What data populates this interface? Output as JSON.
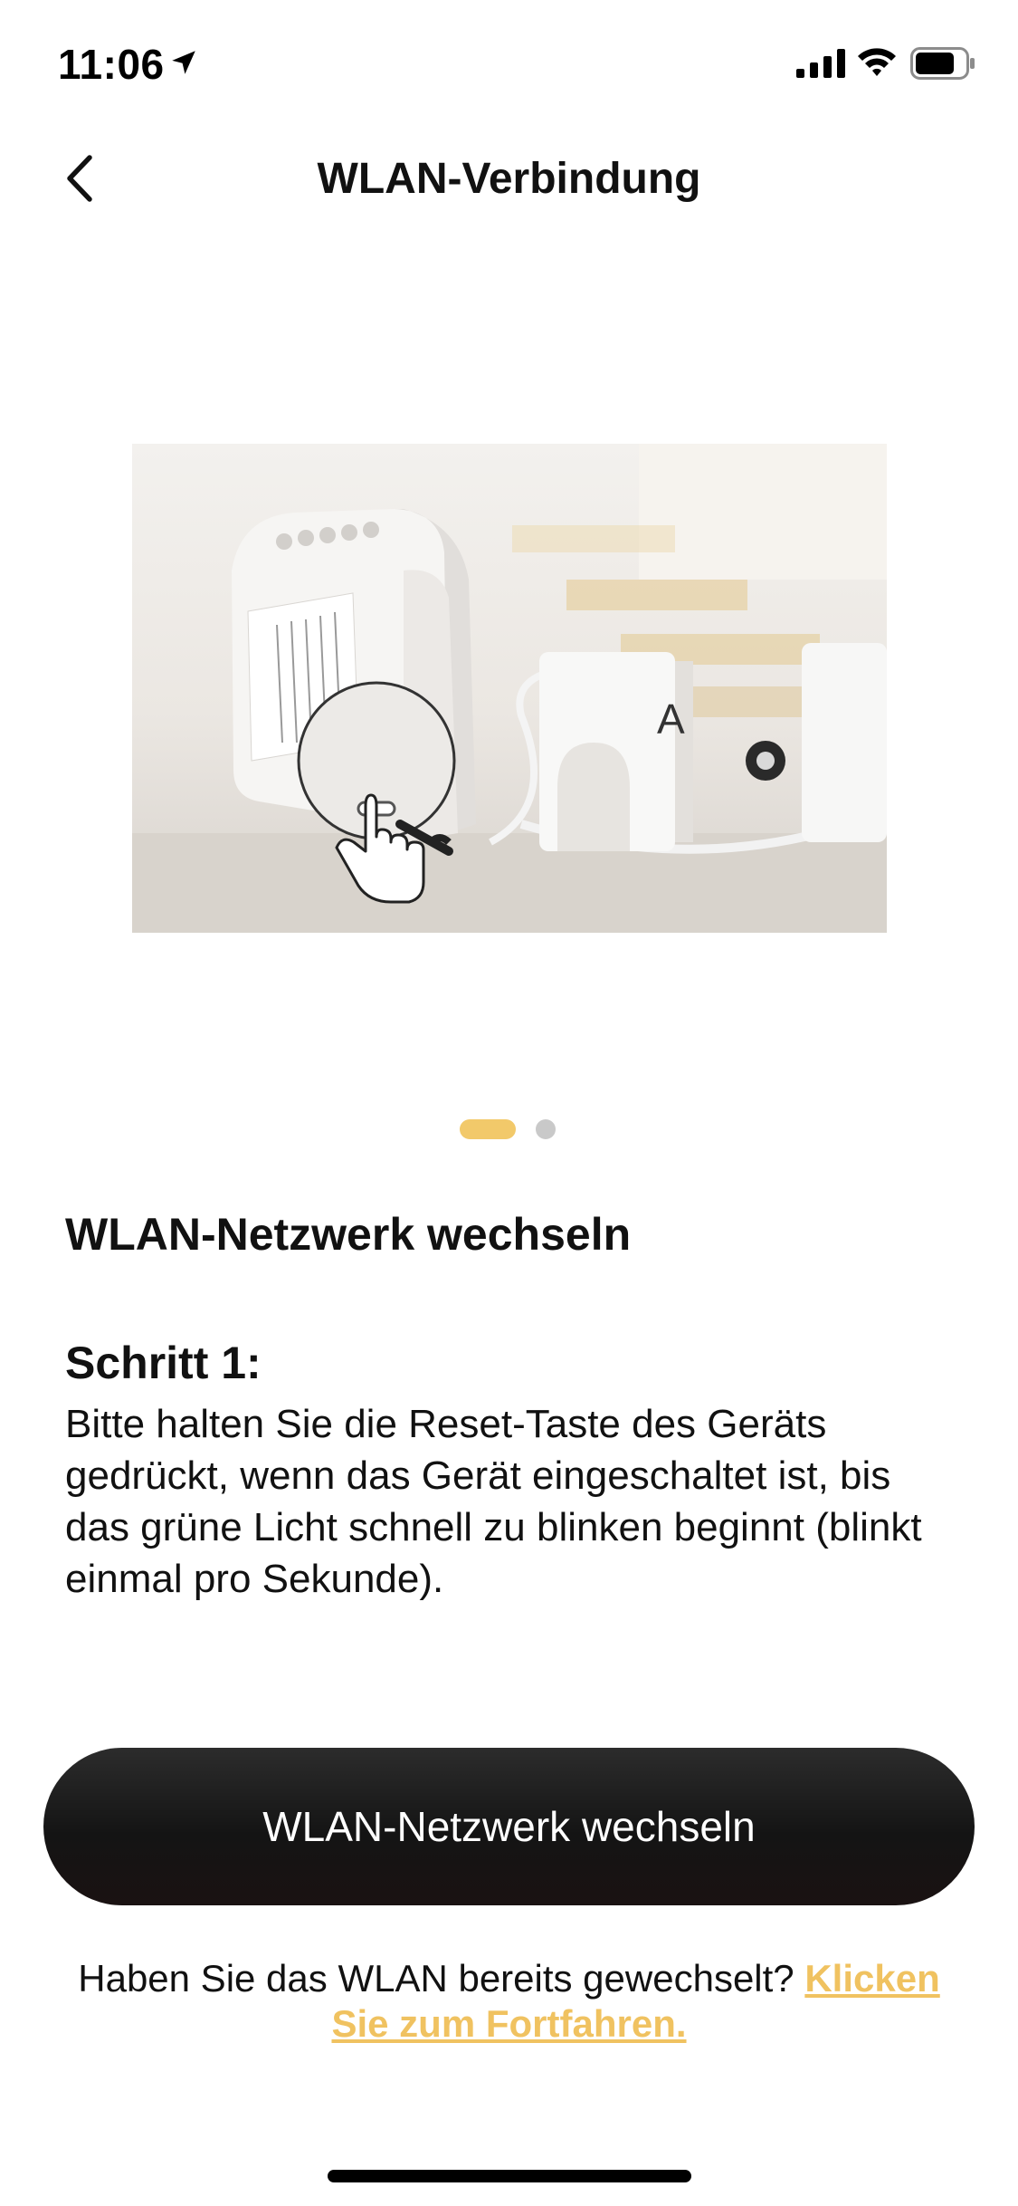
{
  "status_bar": {
    "time": "11:06",
    "icons": [
      "location-arrow-icon",
      "cellular-signal-icon",
      "wifi-icon",
      "battery-icon"
    ]
  },
  "nav": {
    "back_icon": "chevron-left-icon",
    "title": "WLAN-Verbindung"
  },
  "illustration": {
    "device_label": "A",
    "icon": "hand-pointer-icon"
  },
  "pager": {
    "pages": 2,
    "active_index": 0
  },
  "content": {
    "section_title": "WLAN-Netzwerk wechseln",
    "step_title": "Schritt 1:",
    "step_body": "Bitte halten Sie die Reset-Taste des Geräts gedrückt, wenn das Gerät eingeschaltet ist, bis das grüne Licht schnell zu blinken beginnt (blinkt einmal pro Sekunde)."
  },
  "primary_button": {
    "label": "WLAN-Netzwerk wechseln"
  },
  "footer": {
    "question": "Haben Sie das WLAN bereits gewechselt? ",
    "link": "Klicken Sie zum Fortfahren."
  },
  "colors": {
    "accent": "#f2c96a",
    "link": "#f0c260",
    "button_bg": "#1a1a1a",
    "text": "#111111",
    "inactive_dot": "#c9c9c9"
  }
}
